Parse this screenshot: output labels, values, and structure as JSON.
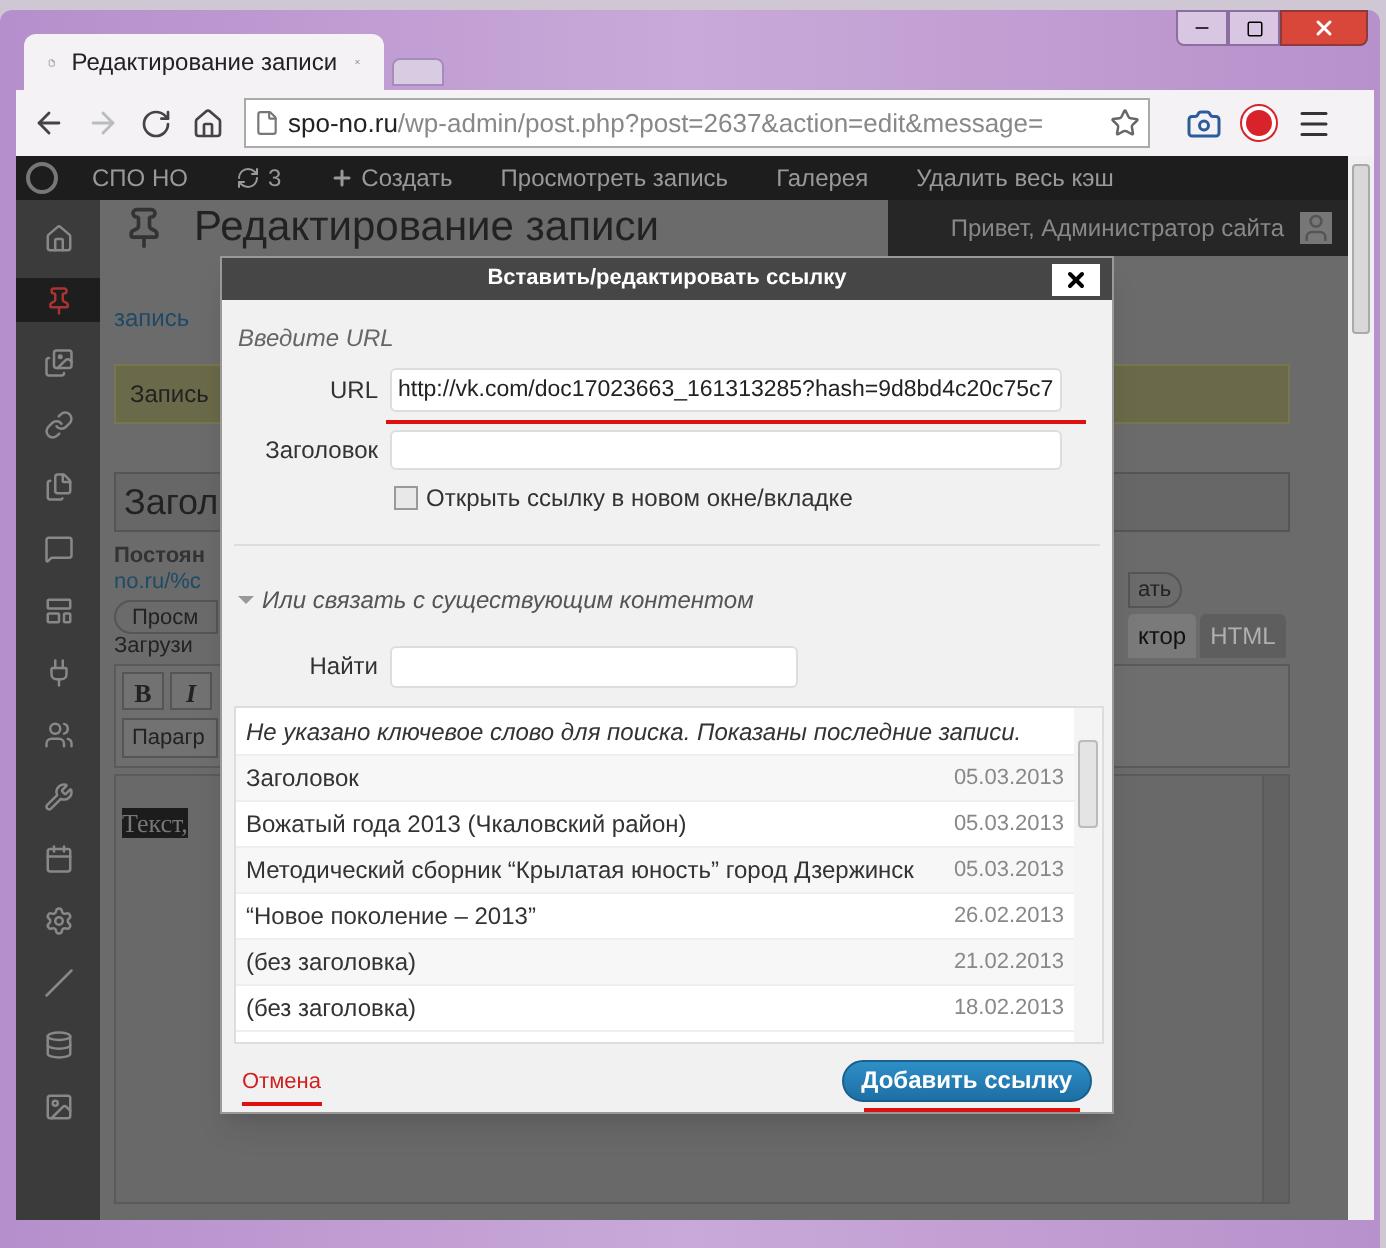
{
  "browser": {
    "tab": {
      "title": "Редактирование записи",
      "selected": true
    },
    "address": {
      "host": "spo-no.ru",
      "path": "/wp-admin/post.php?post=2637&action=edit&message="
    },
    "forward_disabled": true
  },
  "admin_bar": {
    "items": [
      {
        "kind": "logo"
      },
      {
        "kind": "text",
        "label": "СПО НО"
      },
      {
        "kind": "updates",
        "label": "3"
      },
      {
        "kind": "new",
        "label": "Создать"
      },
      {
        "kind": "text",
        "label": "Просмотреть запись"
      },
      {
        "kind": "text",
        "label": "Галерея"
      },
      {
        "kind": "text",
        "label": "Удалить весь кэш"
      }
    ],
    "greeting": "Привет, Администратор сайта"
  },
  "sidebar": {
    "items": [
      {
        "kind": "home",
        "selected": false
      },
      {
        "kind": "pin",
        "selected": true
      },
      {
        "kind": "media",
        "selected": false
      },
      {
        "kind": "link",
        "selected": false
      },
      {
        "kind": "pages",
        "selected": false
      },
      {
        "kind": "comments",
        "selected": false
      },
      {
        "kind": "appearance",
        "selected": false
      },
      {
        "kind": "plugins",
        "selected": false
      },
      {
        "kind": "users",
        "selected": false
      },
      {
        "kind": "tools",
        "selected": false
      },
      {
        "kind": "calendar",
        "selected": false
      },
      {
        "kind": "settings",
        "selected": false
      },
      {
        "kind": "slash",
        "selected": false
      },
      {
        "kind": "database",
        "selected": false
      },
      {
        "kind": "gallery",
        "selected": false
      }
    ]
  },
  "page": {
    "heading": "Редактирование записи",
    "add_link": "запись",
    "notice": "Запись",
    "title_field": "Загол",
    "permalink_label": "Постоян",
    "permalink_url": "no.ru/%c",
    "preview_button": "Просм",
    "upload_label": "Загрузи",
    "right_button": "ать",
    "editor_tabs": [
      {
        "label": "ктор",
        "selected": true
      },
      {
        "label": "HTML",
        "selected": false
      }
    ],
    "format_buttons": [
      {
        "label": "B",
        "kind": "bold"
      },
      {
        "label": "I",
        "kind": "italic"
      }
    ],
    "format_select": "Парагр",
    "editor_text": "Текст,"
  },
  "dialog": {
    "title": "Вставить/редактировать ссылку",
    "section_label": "Введите URL",
    "url": {
      "label": "URL",
      "value": "http://vk.com/doc17023663_161313285?hash=9d8bd4c20c75c7"
    },
    "title_field": {
      "label": "Заголовок"
    },
    "new_window": {
      "label": "Открыть ссылку в новом окне/вкладке",
      "checked": false
    },
    "expander": {
      "label": "Или связать с существующим контентом",
      "expanded": true
    },
    "search": {
      "label": "Найти"
    },
    "results": {
      "notice": "Не указано ключевое слово для поиска. Показаны последние записи.",
      "rows": [
        {
          "title": "Заголовок",
          "date": "05.03.2013"
        },
        {
          "title": "Вожатый года 2013 (Чкаловский район)",
          "date": "05.03.2013"
        },
        {
          "title": "Методический сборник “Крылатая юность” город Дзержинск",
          "date": "05.03.2013"
        },
        {
          "title": "“Новое поколение – 2013”",
          "date": "26.02.2013"
        },
        {
          "title": "(без заголовка)",
          "date": "21.02.2013"
        },
        {
          "title": "(без заголовка)",
          "date": "18.02.2013"
        }
      ]
    },
    "cancel": "Отмена",
    "submit": "Добавить ссылку"
  }
}
